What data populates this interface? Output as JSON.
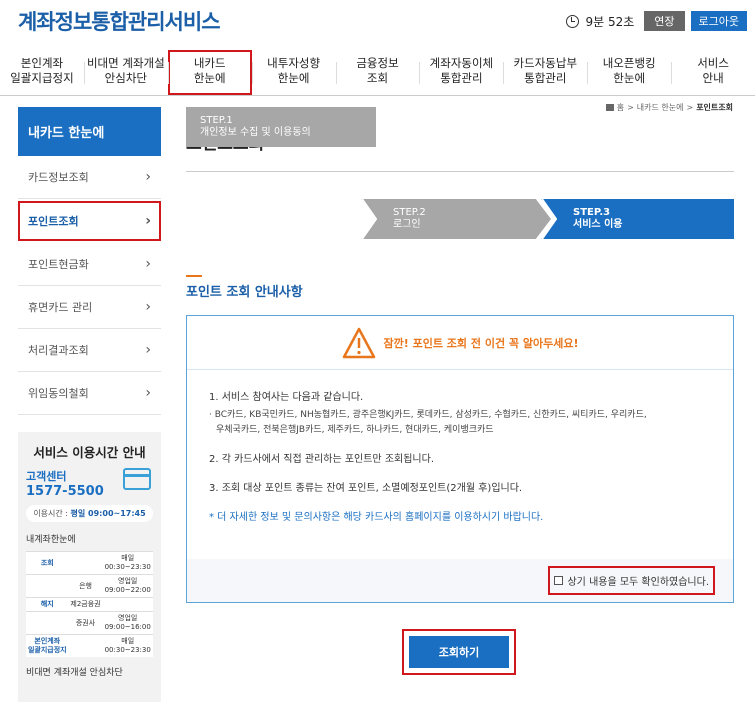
{
  "header": {
    "title": "계좌정보통합관리서비스",
    "timer": "9분 52초",
    "extend_label": "연장",
    "logout_label": "로그아웃"
  },
  "nav": [
    {
      "line1": "본인계좌",
      "line2": "일괄지급정지"
    },
    {
      "line1": "비대면 계좌개설",
      "line2": "안심차단"
    },
    {
      "line1": "내카드",
      "line2": "한눈에"
    },
    {
      "line1": "내투자성향",
      "line2": "한눈에"
    },
    {
      "line1": "금융정보",
      "line2": "조회"
    },
    {
      "line1": "계좌자동이체",
      "line2": "통합관리"
    },
    {
      "line1": "카드자동납부",
      "line2": "통합관리"
    },
    {
      "line1": "내오픈뱅킹",
      "line2": "한눈에"
    },
    {
      "line1": "서비스",
      "line2": "안내"
    }
  ],
  "breadcrumb": [
    "홈",
    "내카드 한눈에",
    "포인트조회"
  ],
  "sidebar": {
    "title": "내카드 한눈에",
    "items": [
      {
        "label": "카드정보조회"
      },
      {
        "label": "포인트조회"
      },
      {
        "label": "포인트현금화"
      },
      {
        "label": "휴면카드 관리"
      },
      {
        "label": "처리결과조회"
      },
      {
        "label": "위임동의철회"
      }
    ]
  },
  "service_box": {
    "title": "서비스 이용시간 안내",
    "cc_label": "고객센터",
    "cc_number": "1577-5500",
    "hours_prefix": "이용시간 : ",
    "hours_value": "평일 09:00~17:45",
    "section1": "내계좌한눈에",
    "rows": [
      {
        "k": "조회",
        "sub": "",
        "v1": "매일",
        "v2": "00:30~23:30"
      },
      {
        "k": "",
        "sub": "은행",
        "v1": "영업일",
        "v2": "09:00~22:00"
      },
      {
        "k": "해지",
        "sub": "제2금융권",
        "v1": "",
        "v2": ""
      },
      {
        "k": "",
        "sub": "증권사",
        "v1": "영업일",
        "v2": "09:00~16:00"
      },
      {
        "k": "본인계좌\n일괄지급정지",
        "sub": "",
        "v1": "매일",
        "v2": "00:30~23:30"
      }
    ],
    "section2": "비대면 계좌개설 안심차단"
  },
  "main": {
    "title": "포인트조회",
    "steps": [
      {
        "num": "STEP.1",
        "label": "개인정보 수집 및 이용동의"
      },
      {
        "num": "STEP.2",
        "label": "로그인"
      },
      {
        "num": "STEP.3",
        "label": "서비스 이용"
      }
    ],
    "section_title": "포인트 조회 안내사항",
    "warning": "잠깐! 포인트 조회 전 이건 꼭 알아두세요!",
    "item1": "1. 서비스 참여사는 다음과 같습니다.",
    "bullet_line1": "· BC카드, KB국민카드, NH농협카드, 광주은행KJ카드, 롯데카드, 삼성카드, 수협카드, 신한카드, 씨티카드, 우리카드,",
    "bullet_line2": "우체국카드, 전북은행JB카드, 제주카드, 하나카드, 현대카드, 케이뱅크카드",
    "item2": "2. 각 카드사에서 직접 관리하는 포인트만 조회됩니다.",
    "item3": "3. 조회 대상 포인트 종류는 잔여 포인트, 소멸예정포인트(2개월 후)입니다.",
    "note": "* 더 자세한 정보 및 문의사항은 해당 카드사의 홈페이지를 이용하시기 바랍니다.",
    "agree_label": "상기 내용을 모두 확인하였습니다.",
    "submit_label": "조회하기"
  }
}
